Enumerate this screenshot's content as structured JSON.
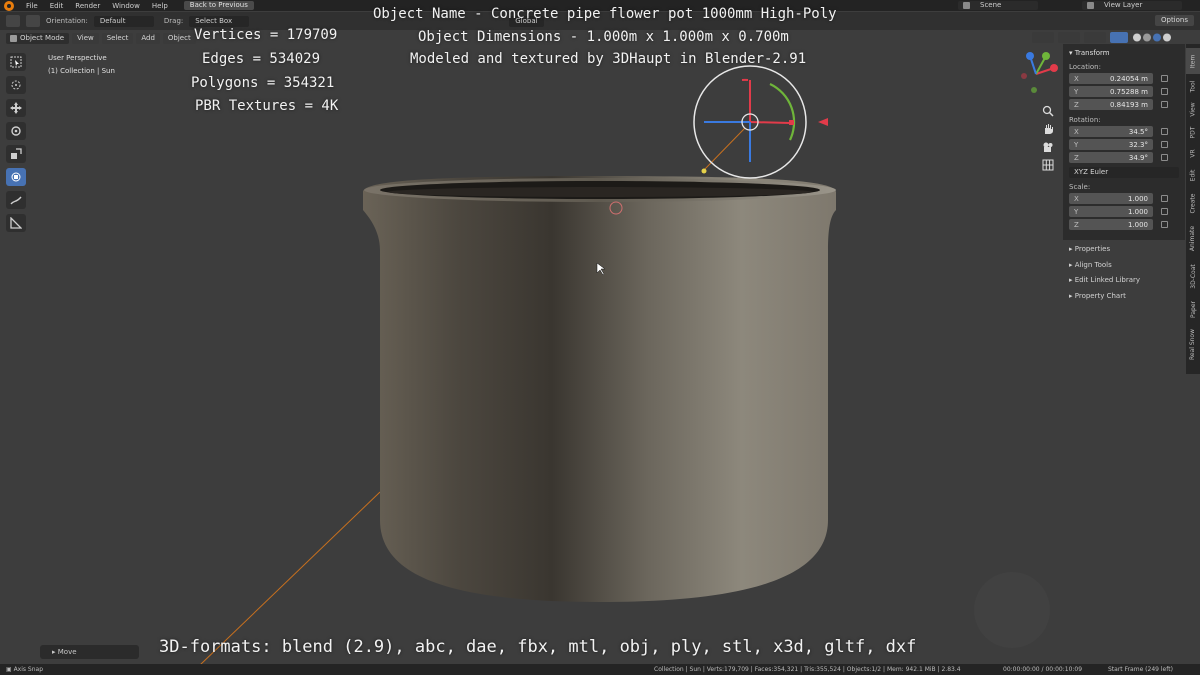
{
  "menu": {
    "items": [
      "File",
      "Edit",
      "Render",
      "Window",
      "Help"
    ],
    "back_button": "Back to Previous",
    "scene": "Scene",
    "view_layer": "View Layer"
  },
  "toolbar": {
    "orientation_label": "Orientation:",
    "orientation_value": "Default",
    "drag_label": "Drag:",
    "drag_value": "Select Box",
    "transform_space": "Global",
    "options_label": "Options"
  },
  "header": {
    "mode": "Object Mode",
    "view": "View",
    "select": "Select",
    "add": "Add",
    "object": "Object"
  },
  "viewport": {
    "perspective": "User Perspective",
    "collection": "(1) Collection | Sun"
  },
  "overlay": {
    "vertices": "Vertices = 179709",
    "edges": "Edges = 534029",
    "polygons": "Polygons = 354321",
    "textures": "PBR Textures = 4K",
    "object_name": "Object Name - Concrete pipe flower pot 1000mm High-Poly",
    "dimensions": "Object Dimensions -  1.000m x 1.000m x 0.700m",
    "modeled_by": "Modeled and textured by 3DHaupt in Blender-2.91",
    "formats": "3D-formats: blend (2.9), abc, dae, fbx, mtl, obj, ply, stl, x3d, gltf, dxf"
  },
  "npanel": {
    "title": "Transform",
    "location_label": "Location:",
    "location": [
      {
        "axis": "X",
        "value": "0.24054 m"
      },
      {
        "axis": "Y",
        "value": "0.75288 m"
      },
      {
        "axis": "Z",
        "value": "0.84193 m"
      }
    ],
    "rotation_label": "Rotation:",
    "rotation": [
      {
        "axis": "X",
        "value": "34.5°"
      },
      {
        "axis": "Y",
        "value": "32.3°"
      },
      {
        "axis": "Z",
        "value": "34.9°"
      }
    ],
    "rotation_mode": "XYZ Euler",
    "scale_label": "Scale:",
    "scale": [
      {
        "axis": "X",
        "value": "1.000"
      },
      {
        "axis": "Y",
        "value": "1.000"
      },
      {
        "axis": "Z",
        "value": "1.000"
      }
    ],
    "sections": [
      "Properties",
      "Align Tools",
      "Edit Linked Library",
      "Property Chart"
    ]
  },
  "tabs": [
    "Item",
    "Tool",
    "View",
    "PDT",
    "VR",
    "Edit",
    "Create",
    "Animate",
    "3D-Coat",
    "Paper",
    "Real Snow"
  ],
  "last_operator": "Move",
  "status": {
    "left": "Axis Snap",
    "stats": "Collection | Sun | Verts:179,709 | Faces:354,321 | Tris:355,524 | Objects:1/2 | Mem: 942.1 MiB | 2.83.4",
    "time": "00:00:00:00 / 00:00:10:09",
    "frame": "Start Frame (249 left)"
  },
  "colors": {
    "accent": "#4772b3",
    "blender_orange": "#e87d0d",
    "gizmo_x": "#e23b4a",
    "gizmo_y": "#6fb53a",
    "gizmo_z": "#3a7ae0"
  }
}
